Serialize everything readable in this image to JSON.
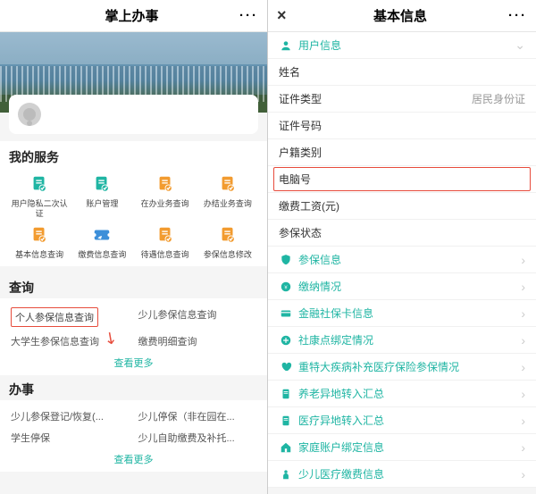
{
  "left": {
    "title": "掌上办事",
    "more": "···",
    "usercard_name": " ",
    "services_title": "我的服务",
    "services": [
      {
        "label": "用户隐私二次认证",
        "color": "#1fb5a3",
        "shape": "doc"
      },
      {
        "label": "账户管理",
        "color": "#1fb5a3",
        "shape": "doc"
      },
      {
        "label": "在办业务查询",
        "color": "#f29b2f",
        "shape": "doc"
      },
      {
        "label": "办结业务查询",
        "color": "#f29b2f",
        "shape": "doc"
      },
      {
        "label": "基本信息查询",
        "color": "#f29b2f",
        "shape": "doc"
      },
      {
        "label": "缴费信息查询",
        "color": "#3d8fd9",
        "shape": "ticket"
      },
      {
        "label": "待遇信息查询",
        "color": "#f29b2f",
        "shape": "doc"
      },
      {
        "label": "参保信息修改",
        "color": "#f29b2f",
        "shape": "doc"
      }
    ],
    "query_title": "查询",
    "query_items": [
      {
        "label": "个人参保信息查询",
        "highlight": true
      },
      {
        "label": "少儿参保信息查询"
      },
      {
        "label": "大学生参保信息查询"
      },
      {
        "label": "缴费明细查询"
      }
    ],
    "viewmore": "查看更多",
    "banshi_title": "办事",
    "banshi_items": [
      {
        "label": "少儿参保登记/恢复(..."
      },
      {
        "label": "少儿停保（非在园在..."
      },
      {
        "label": "学生停保"
      },
      {
        "label": "少儿自助缴费及补托..."
      }
    ]
  },
  "right": {
    "title": "基本信息",
    "more": "···",
    "close": "×",
    "section_user": "用户信息",
    "info_rows": [
      {
        "label": "姓名",
        "value": ""
      },
      {
        "label": "证件类型",
        "value": "居民身份证"
      },
      {
        "label": "证件号码",
        "value": ""
      },
      {
        "label": "户籍类别",
        "value": ""
      },
      {
        "label": "电脑号",
        "value": "",
        "hl": true
      },
      {
        "label": "缴费工资(元)",
        "value": ""
      },
      {
        "label": "参保状态",
        "value": ""
      }
    ],
    "link_rows": [
      {
        "label": "参保信息",
        "icon": "shield"
      },
      {
        "label": "缴纳情况",
        "icon": "coin"
      },
      {
        "label": "金融社保卡信息",
        "icon": "card"
      },
      {
        "label": "社康点绑定情况",
        "icon": "plus"
      },
      {
        "label": "重特大疾病补充医疗保险参保情况",
        "icon": "heart"
      },
      {
        "label": "养老异地转入汇总",
        "icon": "doc"
      },
      {
        "label": "医疗异地转入汇总",
        "icon": "doc"
      },
      {
        "label": "家庭账户绑定信息",
        "icon": "home"
      },
      {
        "label": "少儿医疗缴费信息",
        "icon": "child"
      }
    ]
  }
}
